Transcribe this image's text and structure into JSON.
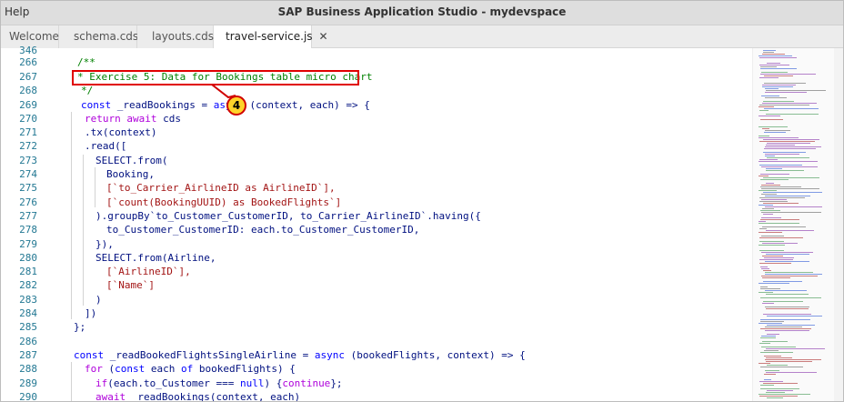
{
  "window": {
    "menu": "Help",
    "title": "SAP Business Application Studio - mydevspace"
  },
  "tabs": [
    {
      "label": "Welcome"
    },
    {
      "label": "schema.cds"
    },
    {
      "label": "layouts.cds"
    },
    {
      "label": "travel-service.js",
      "close": "✕"
    }
  ],
  "annotation": {
    "badge": "4"
  },
  "code_lines": [
    {
      "n": "346"
    },
    {
      "n": "266"
    },
    {
      "n": "267"
    },
    {
      "n": "268"
    },
    {
      "n": "269"
    },
    {
      "n": "270"
    },
    {
      "n": "271"
    },
    {
      "n": "272"
    },
    {
      "n": "273"
    },
    {
      "n": "274"
    },
    {
      "n": "275"
    },
    {
      "n": "276"
    },
    {
      "n": "277"
    },
    {
      "n": "278"
    },
    {
      "n": "279"
    },
    {
      "n": "280"
    },
    {
      "n": "281"
    },
    {
      "n": "282"
    },
    {
      "n": "283"
    },
    {
      "n": "284"
    },
    {
      "n": "285"
    },
    {
      "n": "286"
    },
    {
      "n": "287"
    },
    {
      "n": "288"
    },
    {
      "n": "289"
    },
    {
      "n": "290"
    }
  ],
  "code": {
    "l266": "/**",
    "l267": "* Exercise 5: Data for Bookings table micro chart",
    "l268": "*/",
    "l269a": "const",
    "l269b": " _readBookings = ",
    "l269c": "async",
    "l269d": " (context, each) => {",
    "l270a": "return",
    "l270b": " ",
    "l270c": "await",
    "l270d": " cds",
    "l271": ".tx(context)",
    "l272": ".read([",
    "l273a": "SELECT",
    "l273b": ".from(",
    "l274": "Booking,",
    "l275": "[`to_Carrier_AirlineID as AirlineID`],",
    "l276": "[`count(BookingUUID) as BookedFlights`]",
    "l277": ").groupBy`to_Customer_CustomerID, to_Carrier_AirlineID`.having({",
    "l278": "to_Customer_CustomerID: each.to_Customer_CustomerID,",
    "l279": "}),",
    "l280a": "SELECT",
    "l280b": ".from(Airline,",
    "l281": "[`AirlineID`],",
    "l282": "[`Name`]",
    "l283": ")",
    "l284": "])",
    "l285": "};",
    "l287a": "const",
    "l287b": " _readBookedFlightsSingleAirline = ",
    "l287c": "async",
    "l287d": " (bookedFlights, context) => {",
    "l288a": "for",
    "l288b": " (",
    "l288c": "const",
    "l288d": " each ",
    "l288e": "of",
    "l288f": " bookedFlights) {",
    "l289a": "if",
    "l289b": "(each.to_Customer === ",
    "l289c": "null",
    "l289d": ") {",
    "l289e": "continue",
    "l289f": "};",
    "l290a": "await",
    "l290b": " _readBookings(context, each)"
  }
}
